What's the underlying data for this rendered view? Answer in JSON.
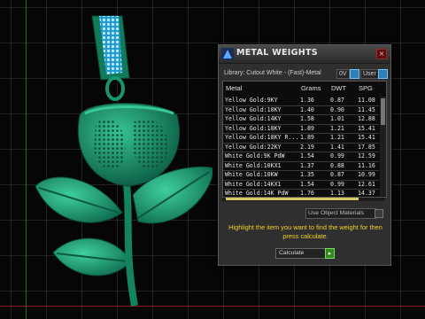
{
  "panel": {
    "title": "METAL WEIGHTS",
    "close_glyph": "×",
    "library_label": "Library: Cutout White - (Fast)-Metal",
    "toggle_0v": "0V",
    "toggle_user": "User",
    "columns": [
      "Metal",
      "Grams",
      "DWT",
      "SPG"
    ],
    "rows": [
      [
        "Yellow Gold:9KY",
        "1.36",
        "0.87",
        "11.08"
      ],
      [
        "Yellow Gold:10KY",
        "1.40",
        "0.90",
        "11.45"
      ],
      [
        "Yellow Gold:14KY",
        "1.58",
        "1.01",
        "12.88"
      ],
      [
        "Yellow Gold:18KY",
        "1.89",
        "1.21",
        "15.41"
      ],
      [
        "Yellow Gold:18KY R...",
        "1.89",
        "1.21",
        "15.41"
      ],
      [
        "Yellow Gold:22KY",
        "2.19",
        "1.41",
        "17.85"
      ],
      [
        "White Gold:9K PdW",
        "1.54",
        "0.99",
        "12.59"
      ],
      [
        "White Gold:10KX1",
        "1.37",
        "0.88",
        "11.16"
      ],
      [
        "White Gold:10KW",
        "1.35",
        "0.87",
        "10.99"
      ],
      [
        "White Gold:14KX1",
        "1.54",
        "0.99",
        "12.61"
      ],
      [
        "White Gold:14K PdW",
        "1.76",
        "1.13",
        "14.37"
      ]
    ],
    "use_materials_label": "Use Object Materials",
    "instruction": "Highlight the item you want to find the weight for then press calculate.",
    "calculate_label": "Calculate",
    "calculate_go_glyph": "▸"
  },
  "icons": {
    "title_icon": "rings-logo-icon",
    "close": "close-icon"
  },
  "colors": {
    "model_green": "#1fa27a",
    "model_dark": "#0d5e47",
    "bail_blue": "#2aa8d8",
    "instruction_yellow": "#f2d22a",
    "toggle_blue": "#2e7fb5"
  }
}
